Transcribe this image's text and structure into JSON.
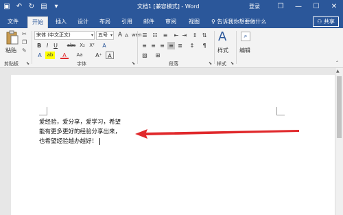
{
  "titlebar": {
    "doc_title": "文档1 [兼容模式] - Word",
    "login": "登录",
    "qat": {
      "save_icon": "▣",
      "undo_icon": "↶",
      "redo_icon": "↻",
      "print_icon": "▤",
      "customize_icon": "▾"
    },
    "win": {
      "restore_icon": "❐",
      "minimize_icon": "—",
      "maximize_icon": "☐",
      "close_icon": "✕"
    }
  },
  "tabs": [
    "文件",
    "开始",
    "插入",
    "设计",
    "布局",
    "引用",
    "邮件",
    "审阅",
    "视图"
  ],
  "active_tab": "开始",
  "tellme": "告诉我你想要做什么",
  "tellme_icon": "♀",
  "share": "共享",
  "share_icon": "⚇",
  "ribbon": {
    "clipboard": {
      "paste_label": "粘贴",
      "group_label": "剪贴板"
    },
    "font": {
      "font_name": "宋体 (中文正文)",
      "font_size": "五号",
      "group_label": "字体",
      "row2": [
        "B",
        "I",
        "U",
        "abc",
        "X₂",
        "X²",
        "A"
      ],
      "row3": [
        "A",
        "ab",
        "A",
        "Aa",
        "A⁺",
        "A"
      ],
      "grow": "A",
      "shrink": "A",
      "phonetic": "wén"
    },
    "paragraph": {
      "group_label": "段落"
    },
    "styles": {
      "label": "样式",
      "group_label": "样式"
    },
    "editing": {
      "label": "编辑"
    }
  },
  "document": {
    "lines": [
      "爱经验，爱分享，爱学习，希望",
      "能有更多更好的经验分享出来，",
      "也希望经验越办越好！"
    ]
  },
  "colors": {
    "brand": "#2b579a",
    "arrow": "#e0282b",
    "ribbon_bg": "#f3f3f3"
  }
}
